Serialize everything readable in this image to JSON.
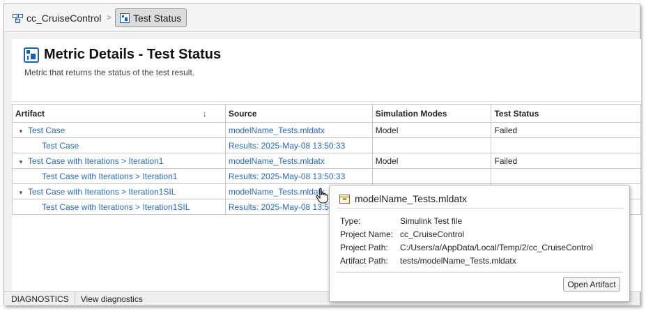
{
  "breadcrumb": {
    "project": "cc_CruiseControl",
    "separator": ">",
    "current": "Test Status"
  },
  "header": {
    "title": "Metric Details - Test Status",
    "subtitle": "Metric that returns the status of the test result."
  },
  "table": {
    "columns": [
      "Artifact",
      "Source",
      "Simulation Modes",
      "Test Status"
    ],
    "rows": [
      {
        "artifact": "Test Case",
        "source": "modelName_Tests.mldatx",
        "mode": "Model",
        "status": "Failed",
        "expandable": true
      },
      {
        "artifact": "Test Case",
        "source": "Results: 2025-May-08 13:50:33",
        "mode": "",
        "status": "",
        "expandable": false
      },
      {
        "artifact": "Test Case with Iterations > Iteration1",
        "source": "modelName_Tests.mldatx",
        "mode": "Model",
        "status": "Failed",
        "expandable": true
      },
      {
        "artifact": "Test Case with Iterations > Iteration1",
        "source": "Results: 2025-May-08 13:50:33",
        "mode": "",
        "status": "",
        "expandable": false
      },
      {
        "artifact": "Test Case with Iterations > Iteration1SIL",
        "source": "modelName_Tests.mldatx",
        "mode": "",
        "status": "",
        "expandable": true
      },
      {
        "artifact": "Test Case with Iterations > Iteration1SIL",
        "source": "Results: 2025-May-08 13:50:33",
        "mode": "",
        "status": "",
        "expandable": false
      }
    ]
  },
  "popup": {
    "title": "modelName_Tests.mldatx",
    "fields": [
      {
        "label": "Type:",
        "value": "Simulink Test file"
      },
      {
        "label": "Project Name:",
        "value": "cc_CruiseControl"
      },
      {
        "label": "Project Path:",
        "value": "C:/Users/a/AppData/Local/Temp/2/cc_CruiseControl"
      },
      {
        "label": "Artifact Path:",
        "value": "tests/modelName_Tests.mldatx"
      }
    ],
    "button": "Open Artifact"
  },
  "statusbar": {
    "diagnostics": "DIAGNOSTICS",
    "view": "View diagnostics"
  },
  "colors": {
    "link": "#2a6bb7",
    "accent": "#1f5fa8"
  }
}
